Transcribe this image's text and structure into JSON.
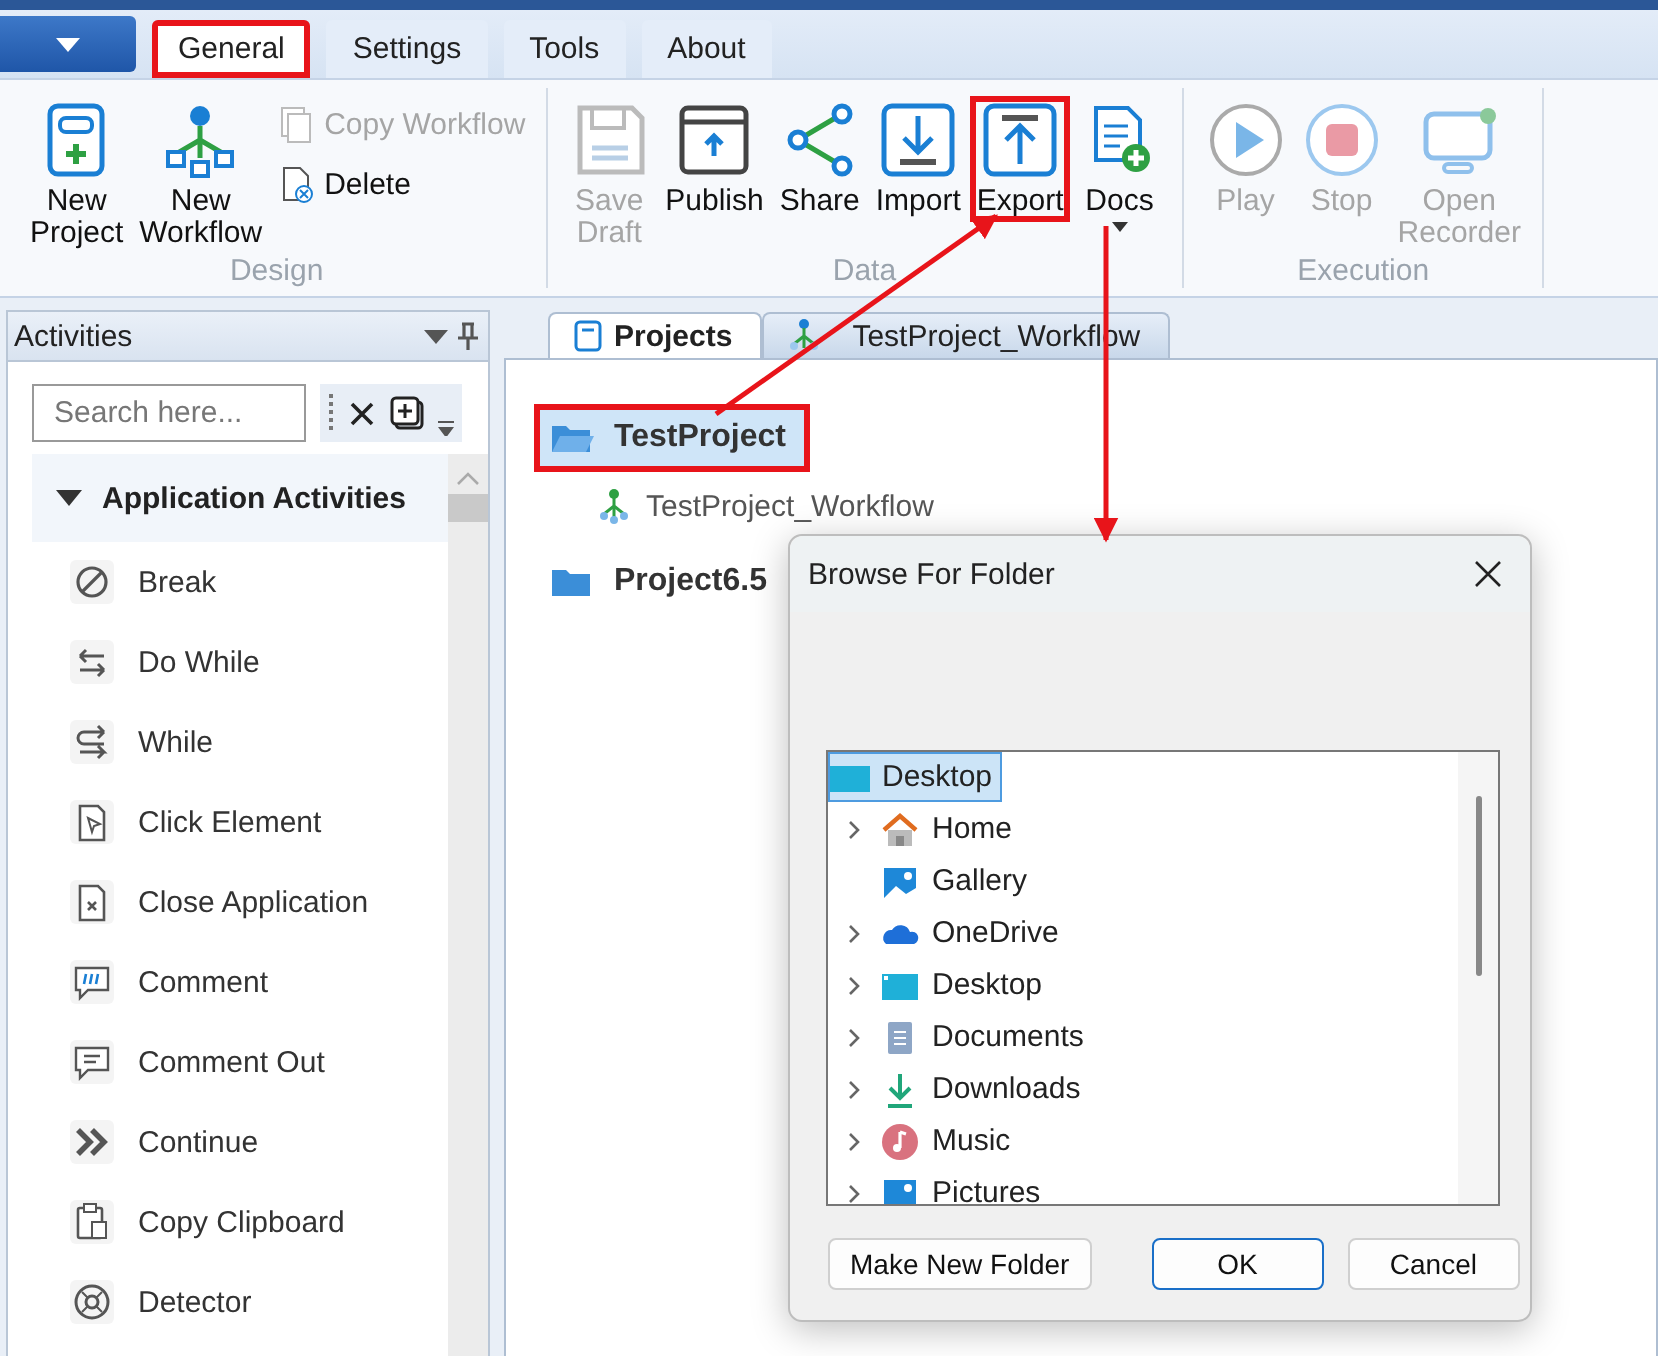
{
  "ribbon_tabs": [
    {
      "label": "General",
      "selected": true,
      "highlighted": true
    },
    {
      "label": "Settings",
      "selected": false,
      "highlighted": false
    },
    {
      "label": "Tools",
      "selected": false,
      "highlighted": false
    },
    {
      "label": "About",
      "selected": false,
      "highlighted": false
    }
  ],
  "ribbon_groups": [
    {
      "label": "Design",
      "buttons": [
        {
          "kind": "large",
          "label": "New Project",
          "disabled": false,
          "highlighted": false,
          "dropdown": false
        },
        {
          "kind": "large",
          "label": "New Workflow",
          "disabled": false,
          "highlighted": false,
          "dropdown": false
        },
        {
          "kind": "small",
          "label": "Copy Workflow",
          "disabled": true
        },
        {
          "kind": "small",
          "label": "Delete",
          "disabled": false
        }
      ]
    },
    {
      "label": "Data",
      "buttons": [
        {
          "kind": "large",
          "label": "Save Draft",
          "disabled": true,
          "highlighted": false,
          "dropdown": false
        },
        {
          "kind": "large",
          "label": "Publish",
          "disabled": false,
          "highlighted": false,
          "dropdown": false
        },
        {
          "kind": "large",
          "label": "Share",
          "disabled": false,
          "highlighted": false,
          "dropdown": false
        },
        {
          "kind": "large",
          "label": "Import",
          "disabled": false,
          "highlighted": false,
          "dropdown": false
        },
        {
          "kind": "large",
          "label": "Export",
          "disabled": false,
          "highlighted": true,
          "dropdown": false
        },
        {
          "kind": "large",
          "label": "Docs",
          "disabled": false,
          "highlighted": false,
          "dropdown": true
        }
      ]
    },
    {
      "label": "Execution",
      "buttons": [
        {
          "kind": "large",
          "label": "Play",
          "disabled": true,
          "highlighted": false,
          "dropdown": false
        },
        {
          "kind": "large",
          "label": "Stop",
          "disabled": true,
          "highlighted": false,
          "dropdown": false
        },
        {
          "kind": "large",
          "label": "Open Recorder",
          "disabled": true,
          "highlighted": false,
          "dropdown": false
        }
      ]
    }
  ],
  "activities": {
    "title": "Activities",
    "search": {
      "placeholder": "Search here..."
    },
    "groups": [
      {
        "label": "Application Activities",
        "expanded": true,
        "children": [
          {
            "label": "Break"
          },
          {
            "label": "Do While"
          },
          {
            "label": "While"
          },
          {
            "label": "Click Element"
          },
          {
            "label": "Close Application"
          },
          {
            "label": "Comment"
          },
          {
            "label": "Comment Out"
          },
          {
            "label": "Continue"
          },
          {
            "label": "Copy Clipboard"
          },
          {
            "label": "Detector"
          }
        ]
      }
    ]
  },
  "document_tabs": [
    {
      "label": "Projects",
      "selected": true
    },
    {
      "label": "TestProject_Workflow",
      "selected": false
    }
  ],
  "project_tree": [
    {
      "label": "TestProject",
      "selected": true,
      "highlighted": true,
      "children": [
        {
          "label": "TestProject_Workflow",
          "selected": false,
          "highlighted": false
        }
      ]
    },
    {
      "label": "Project6.5",
      "selected": false,
      "highlighted": false
    }
  ],
  "dialog": {
    "title": "Browse For Folder",
    "folders": [
      {
        "label": "Desktop",
        "selected": true,
        "children": [
          {
            "label": "Home",
            "selected": false,
            "expandable": true
          },
          {
            "label": "Gallery",
            "selected": false,
            "expandable": false
          },
          {
            "label": "OneDrive",
            "selected": false,
            "expandable": true
          },
          {
            "label": "Desktop",
            "selected": false,
            "expandable": true
          },
          {
            "label": "Documents",
            "selected": false,
            "expandable": true
          },
          {
            "label": "Downloads",
            "selected": false,
            "expandable": true
          },
          {
            "label": "Music",
            "selected": false,
            "expandable": true
          },
          {
            "label": "Pictures",
            "selected": false,
            "expandable": true
          }
        ]
      }
    ],
    "buttons": [
      {
        "label": "Make New Folder",
        "default": false
      },
      {
        "label": "OK",
        "default": true
      },
      {
        "label": "Cancel",
        "default": false
      }
    ]
  }
}
